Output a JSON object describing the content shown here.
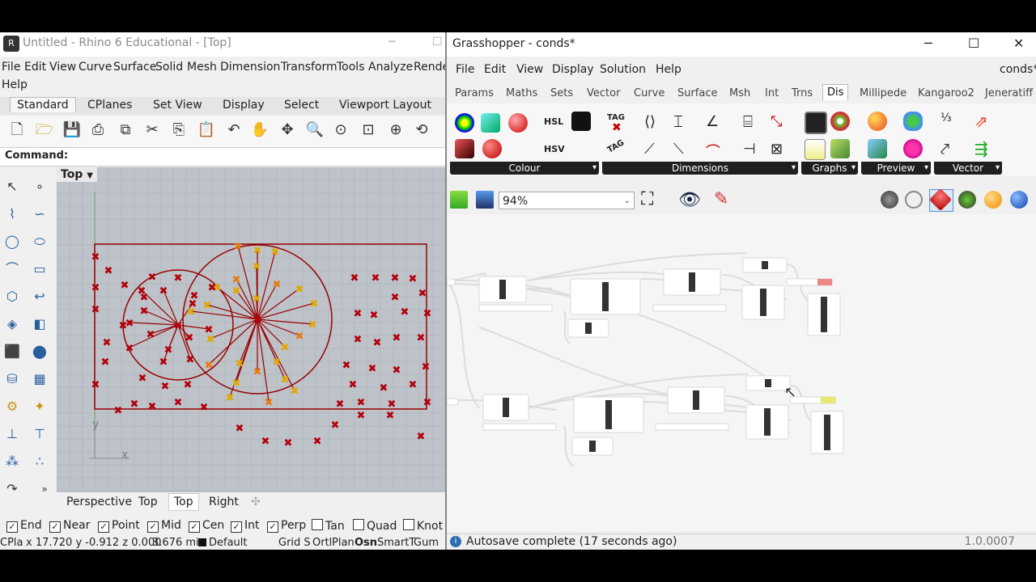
{
  "rhino": {
    "title": "Untitled - Rhino 6 Educational - [Top]",
    "menu": [
      "File",
      "Edit",
      "View",
      "Curve",
      "Surface",
      "Solid",
      "Mesh",
      "Dimension",
      "Transform",
      "Tools",
      "Analyze",
      "Rende",
      "Help"
    ],
    "tabs": [
      "Standard",
      "CPlanes",
      "Set View",
      "Display",
      "Select",
      "Viewport Layout"
    ],
    "command_label": "Command:",
    "viewport_label": "Top",
    "axis_y": "y",
    "axis_x": "x",
    "view_tabs": [
      "Perspective",
      "Top",
      "Top",
      "Right"
    ],
    "osnaps": [
      {
        "label": "End",
        "checked": true
      },
      {
        "label": "Near",
        "checked": true
      },
      {
        "label": "Point",
        "checked": true
      },
      {
        "label": "Mid",
        "checked": true
      },
      {
        "label": "Cen",
        "checked": true
      },
      {
        "label": "Int",
        "checked": true
      },
      {
        "label": "Perp",
        "checked": true
      },
      {
        "label": "Tan",
        "checked": false
      },
      {
        "label": "Quad",
        "checked": false
      },
      {
        "label": "Knot",
        "checked": false
      }
    ],
    "status": {
      "cplane": "CPla",
      "coords": "x 17.720 y -0.912 z 0.000",
      "units": "3.676 mi",
      "layer": "Default",
      "modes": "Grid S",
      "ortho": "Ortl",
      "planar": "Plan",
      "osnap": "Osn",
      "smarttrack": "SmartT",
      "gumball": "Gum"
    },
    "colors": {
      "curve": "#9a0000",
      "point_red": "#b3000b",
      "point_yellow": "#e0a800",
      "point_orange": "#e87a10"
    }
  },
  "gh": {
    "title": "Grasshopper - conds*",
    "doc_name": "conds*",
    "menu": [
      "File",
      "Edit",
      "View",
      "Display",
      "Solution",
      "Help"
    ],
    "tabs": [
      "Params",
      "Maths",
      "Sets",
      "Vector",
      "Curve",
      "Surface",
      "Msh",
      "Int",
      "Trns",
      "Dis",
      "Millipede",
      "Kangaroo2",
      "Jeneratiff"
    ],
    "active_tab": "Dis",
    "ribbon_panels": [
      "Colour",
      "Dimensions",
      "Graphs",
      "Preview",
      "Vector"
    ],
    "ribbon_text": {
      "hsl": "HSL",
      "hsv": "HSV",
      "tag1": "TAG",
      "tag2": "TAG"
    },
    "zoom": "94%",
    "status_message": "Autosave complete (17 seconds ago)",
    "version": "1.0.0007",
    "window_controls": {
      "minimize": "─",
      "maximize": "☐",
      "close": "✕"
    }
  }
}
